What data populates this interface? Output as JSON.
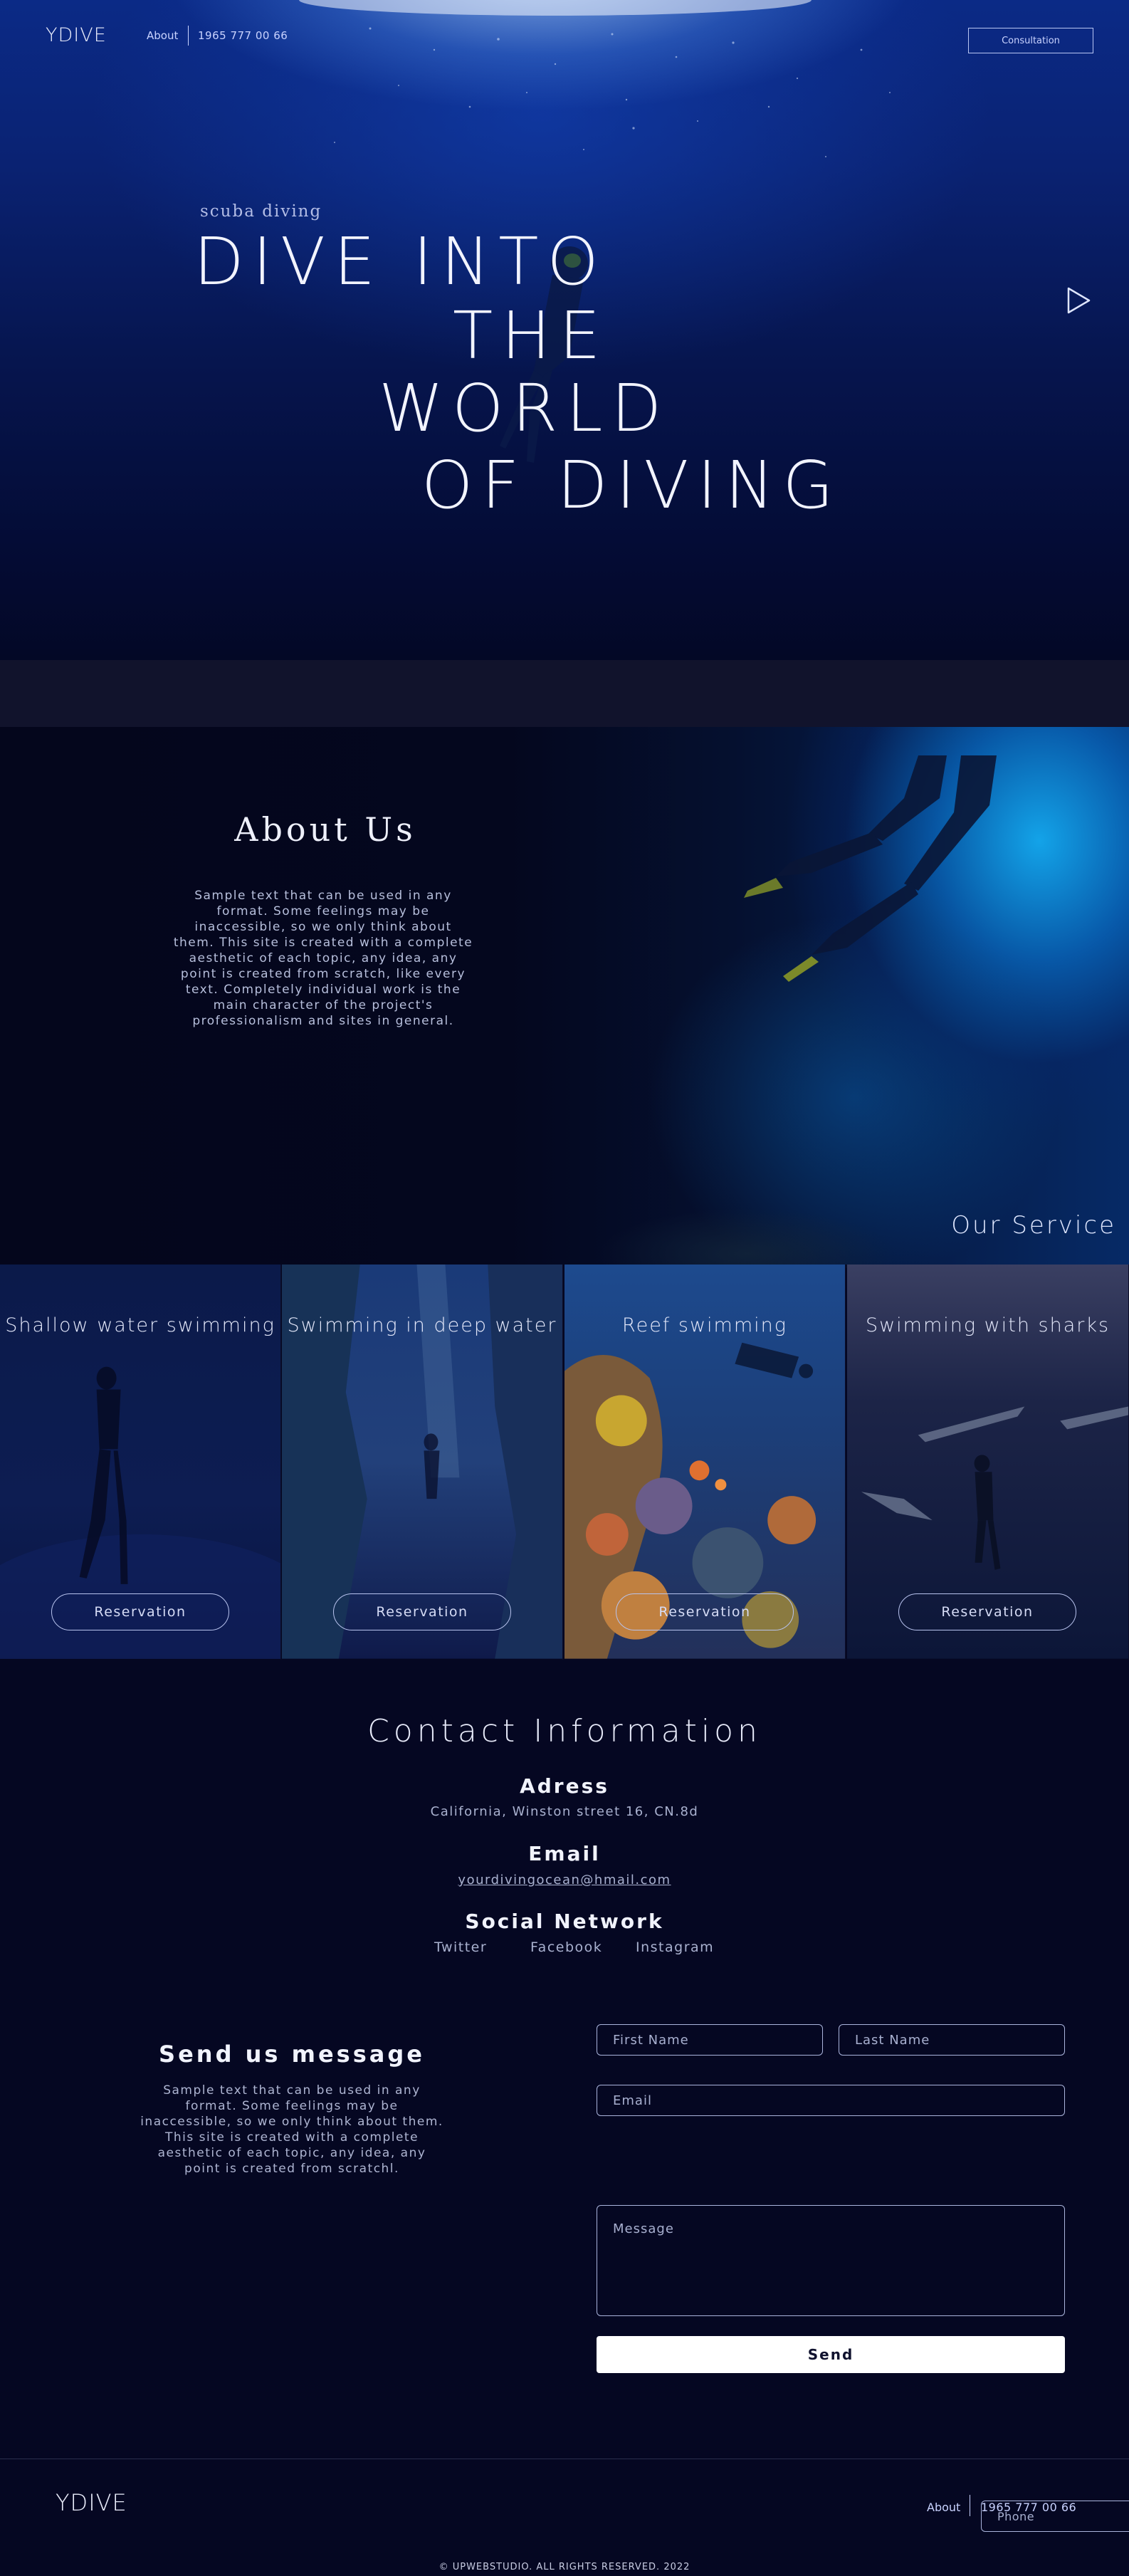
{
  "colors": {
    "background": "#050722",
    "hero_blue": "#0b2a86",
    "accent_text": "#c9d3ff",
    "send_button": "#ffffff"
  },
  "nav": {
    "logo": "YDIVE",
    "about": "About",
    "phone": "1965 777 00 66",
    "consultation": "Consultation"
  },
  "hero": {
    "subtitle": "scuba diving",
    "lines": [
      "DIVE INTO",
      "THE",
      "WORLD",
      "OF DIVING"
    ],
    "play_icon": "play-icon"
  },
  "about": {
    "title": "About Us",
    "text": "Sample text that can be used in any format. Some feelings may be inaccessible, so we only think about them. This site is created with a complete aesthetic of each topic, any idea, any point is created from scratch, like every text. Completely individual work is the main character of the project's professionalism and sites in general."
  },
  "services": {
    "title": "Our Service",
    "cards": [
      {
        "title": "Shallow water swimming",
        "button": "Reservation"
      },
      {
        "title": "Swimming in deep water",
        "button": "Reservation"
      },
      {
        "title": "Reef swimming",
        "button": "Reservation"
      },
      {
        "title": "Swimming with sharks",
        "button": "Reservation"
      }
    ]
  },
  "contact": {
    "title": "Contact Information",
    "address_label": "Adress",
    "address": "California, Winston street 16, CN.8d",
    "email_label": "Email",
    "email": "yourdivingocean@hmail.com",
    "social_label": "Social Network",
    "social": [
      "Twitter",
      "Facebook",
      "Instagram"
    ]
  },
  "form": {
    "title": "Send us message",
    "text": "Sample text that can be used in any format. Some feelings may be inaccessible, so we only think about them. This site is created with a complete aesthetic of each topic, any idea, any point is created from scratchl.",
    "first_name_placeholder": "First Name",
    "last_name_placeholder": "Last Name",
    "email_placeholder": "Email",
    "phone_placeholder": "Phone",
    "message_placeholder": "Message",
    "send": "Send"
  },
  "footer": {
    "logo": "YDIVE",
    "about": "About",
    "phone": "1965 777 00 66",
    "copyright": "© UPWEBSTUDIO. ALL RIGHTS RESERVED. 2022"
  }
}
